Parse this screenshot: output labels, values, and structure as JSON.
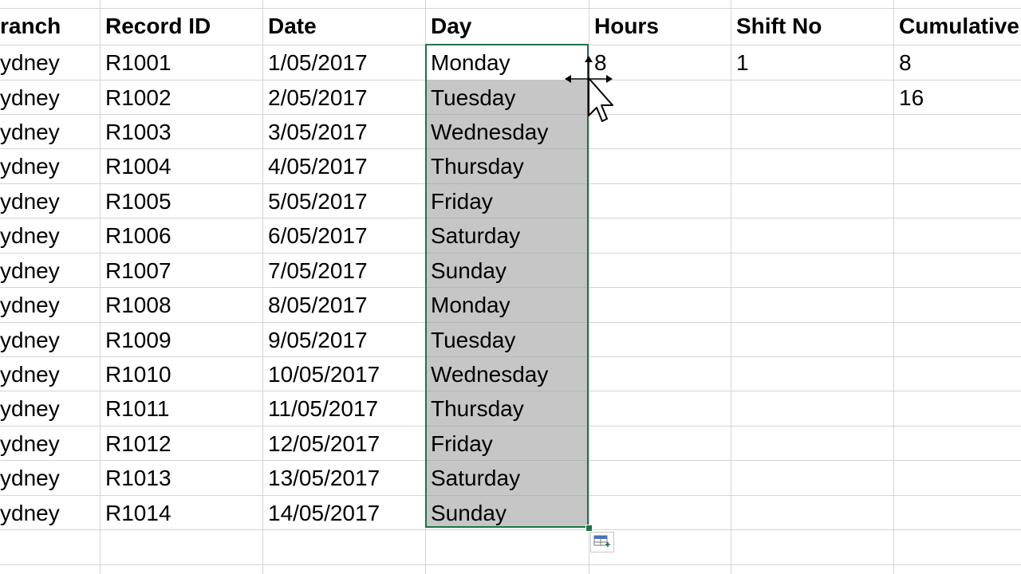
{
  "headers": {
    "branch": "ranch",
    "record_id": "Record ID",
    "date": "Date",
    "day": "Day",
    "hours": "Hours",
    "shift_no": "Shift No",
    "cumulative": "Cumulative"
  },
  "rows": [
    {
      "branch": "ydney",
      "record_id": "R1001",
      "date": "1/05/2017",
      "day": "Monday",
      "hours": "8",
      "shift_no": "1",
      "cumulative": "8"
    },
    {
      "branch": "ydney",
      "record_id": "R1002",
      "date": "2/05/2017",
      "day": "Tuesday",
      "hours": "",
      "shift_no": "",
      "cumulative": "16"
    },
    {
      "branch": "ydney",
      "record_id": "R1003",
      "date": "3/05/2017",
      "day": "Wednesday",
      "hours": "",
      "shift_no": "",
      "cumulative": ""
    },
    {
      "branch": "ydney",
      "record_id": "R1004",
      "date": "4/05/2017",
      "day": "Thursday",
      "hours": "",
      "shift_no": "",
      "cumulative": ""
    },
    {
      "branch": "ydney",
      "record_id": "R1005",
      "date": "5/05/2017",
      "day": "Friday",
      "hours": "",
      "shift_no": "",
      "cumulative": ""
    },
    {
      "branch": "ydney",
      "record_id": "R1006",
      "date": "6/05/2017",
      "day": "Saturday",
      "hours": "",
      "shift_no": "",
      "cumulative": ""
    },
    {
      "branch": "ydney",
      "record_id": "R1007",
      "date": "7/05/2017",
      "day": "Sunday",
      "hours": "",
      "shift_no": "",
      "cumulative": ""
    },
    {
      "branch": "ydney",
      "record_id": "R1008",
      "date": "8/05/2017",
      "day": "Monday",
      "hours": "",
      "shift_no": "",
      "cumulative": ""
    },
    {
      "branch": "ydney",
      "record_id": "R1009",
      "date": "9/05/2017",
      "day": "Tuesday",
      "hours": "",
      "shift_no": "",
      "cumulative": ""
    },
    {
      "branch": "ydney",
      "record_id": "R1010",
      "date": "10/05/2017",
      "day": "Wednesday",
      "hours": "",
      "shift_no": "",
      "cumulative": ""
    },
    {
      "branch": "ydney",
      "record_id": "R1011",
      "date": "11/05/2017",
      "day": "Thursday",
      "hours": "",
      "shift_no": "",
      "cumulative": ""
    },
    {
      "branch": "ydney",
      "record_id": "R1012",
      "date": "12/05/2017",
      "day": "Friday",
      "hours": "",
      "shift_no": "",
      "cumulative": ""
    },
    {
      "branch": "ydney",
      "record_id": "R1013",
      "date": "13/05/2017",
      "day": "Saturday",
      "hours": "",
      "shift_no": "",
      "cumulative": ""
    },
    {
      "branch": "ydney",
      "record_id": "R1014",
      "date": "14/05/2017",
      "day": "Sunday",
      "hours": "",
      "shift_no": "",
      "cumulative": ""
    }
  ],
  "selection": {
    "column": "day",
    "color": "#217346",
    "fill": "#c6c6c6"
  },
  "icons": {
    "cursor": "move-arrow-cursor-icon",
    "quick_analysis": "quick-analysis-icon"
  }
}
